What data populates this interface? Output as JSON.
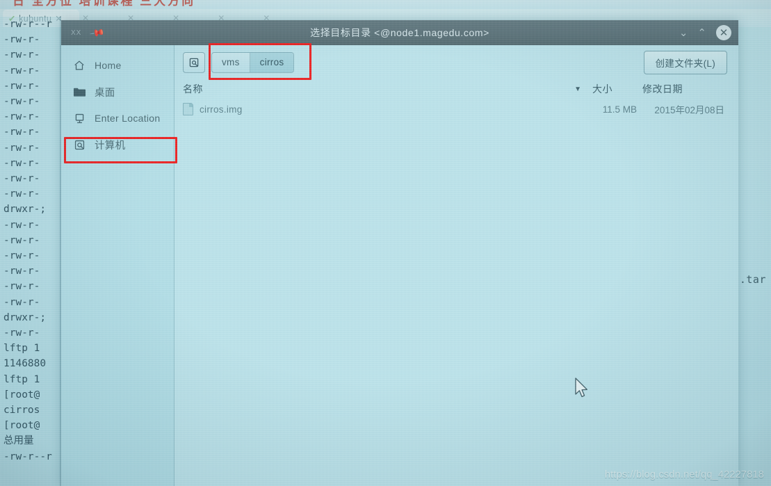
{
  "watermark": "https://blog.csdn.net/qq_42227818",
  "desktop": {
    "top_red_text": "日 全方位 培训课程 三大方向",
    "tab": {
      "label": "kubuntu",
      "check_glyph": "✔",
      "close_glyph": "✕"
    },
    "other_tabs": [
      "✕",
      "✕",
      "✕",
      "✕",
      "✕"
    ],
    "tar_fragment": ".tar",
    "terminal_lines": [
      "-rw-r--r",
      "-rw-r-",
      "-rw-r-",
      "-rw-r-",
      "-rw-r-",
      "-rw-r-",
      "-rw-r-",
      "-rw-r-",
      "-rw-r-",
      "-rw-r-",
      "-rw-r-",
      "-rw-r-",
      "drwxr-;",
      "-rw-r-",
      "-rw-r-",
      "-rw-r-",
      "-rw-r-",
      "-rw-r-",
      "-rw-r-",
      "drwxr-;",
      "-rw-r-",
      "lftp 1",
      "1146880",
      "lftp 1",
      "[root@",
      "cirros",
      "[root@",
      "总用量",
      "-rw-r--r"
    ]
  },
  "dialog": {
    "titlebar": {
      "mini_text": "XX",
      "pin_icon": "pin-icon",
      "title": "选择目标目录 <@node1.magedu.com>",
      "minimize_glyph": "⌄",
      "maximize_glyph": "⌃",
      "close_glyph": "✕"
    },
    "sidebar": {
      "items": [
        {
          "icon": "home-icon",
          "label": "Home",
          "selected": false
        },
        {
          "icon": "folder-icon",
          "label": "桌面",
          "selected": false
        },
        {
          "icon": "enter-location-icon",
          "label": "Enter Location",
          "selected": false
        },
        {
          "icon": "computer-icon",
          "label": "计算机",
          "selected": true
        }
      ]
    },
    "pathbar": {
      "root_icon": "computer-root-icon",
      "crumbs": [
        {
          "label": "vms",
          "active": false
        },
        {
          "label": "cirros",
          "active": true
        }
      ],
      "new_folder_label": "创建文件夹(L)"
    },
    "columns": {
      "name": "名称",
      "sort_arrow": "▼",
      "size": "大小",
      "modified": "修改日期"
    },
    "files": [
      {
        "icon": "document-icon",
        "name": "cirros.img",
        "size": "11.5 MB",
        "modified": "2015年02月08日"
      }
    ]
  },
  "annotations": {
    "highlight_color": "#ee1c1c",
    "boxes": [
      {
        "name": "crumbs-highlight",
        "target": "pathbar-crumbs"
      },
      {
        "name": "computer-highlight",
        "target": "sidebar-item-computer"
      }
    ]
  }
}
